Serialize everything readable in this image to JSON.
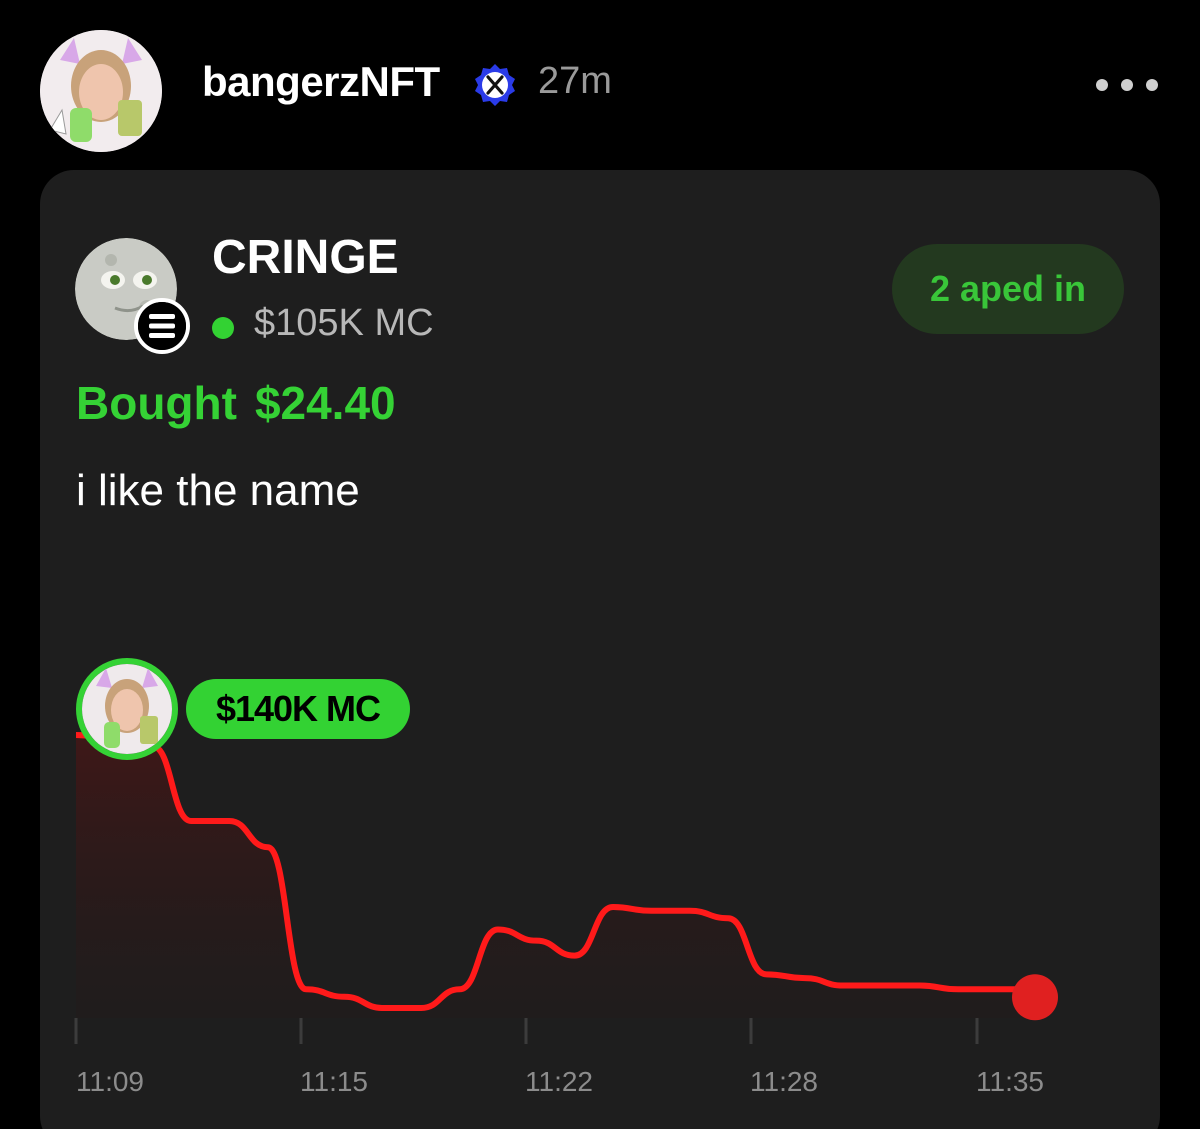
{
  "post": {
    "username": "bangerzNFT",
    "verified_icon": "x-verified-badge-icon",
    "time_ago": "27m",
    "more_icon": "more-dots-icon"
  },
  "token": {
    "name": "CRINGE",
    "chain_icon": "solana-icon",
    "market_cap": "$105K MC",
    "aped_label": "2 aped in"
  },
  "trade": {
    "label": "Bought",
    "amount": "$24.40",
    "comment": "i like the name"
  },
  "chart_data": {
    "type": "line",
    "entry_label": "$140K MC",
    "x_ticks": [
      "11:09",
      "11:15",
      "11:22",
      "11:28",
      "11:35"
    ],
    "line_color": "#ff1a1a",
    "end_marker_color": "#e02020",
    "series": [
      {
        "values_mc_k": [
          140,
          139,
          137,
          117,
          117,
          110,
          72,
          70,
          67,
          67,
          72,
          88,
          85,
          81,
          94,
          93,
          93,
          91,
          76,
          75,
          73,
          73,
          73,
          72,
          72,
          72
        ]
      }
    ]
  },
  "colors": {
    "accent_green": "#33d233",
    "card_bg": "#1e1e1e",
    "page_bg": "#000000"
  }
}
